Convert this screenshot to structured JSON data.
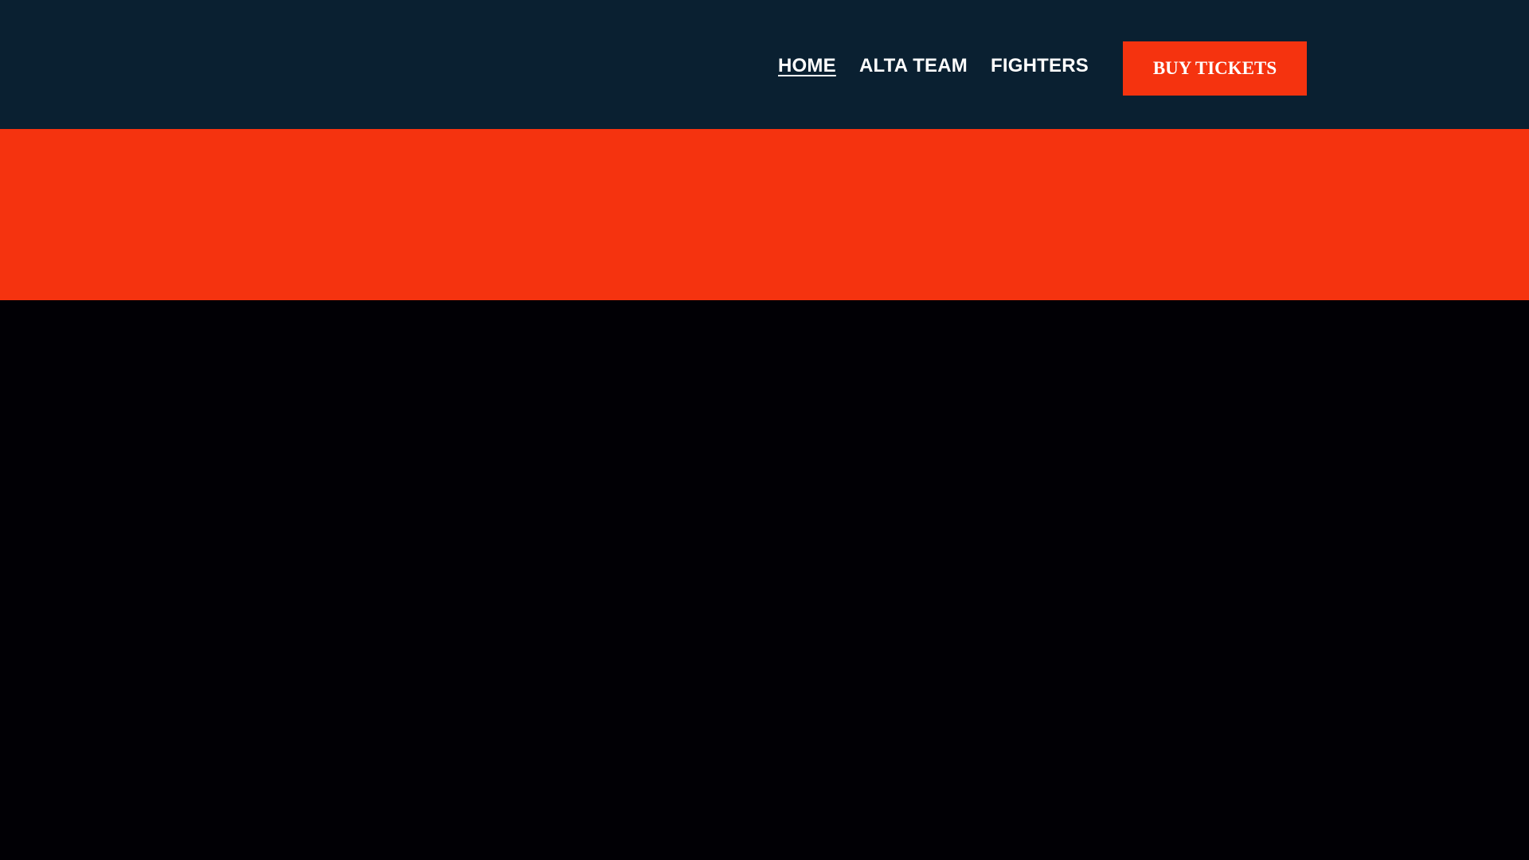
{
  "nav": {
    "items": [
      {
        "label": "HOME",
        "active": true
      },
      {
        "label": "ALTA TEAM",
        "active": false
      },
      {
        "label": "FIGHTERS",
        "active": false
      }
    ],
    "cta_label": "BUY TICKETS"
  },
  "colors": {
    "header_bg": "#0a2031",
    "accent": "#f5330f",
    "body_bg": "#010005"
  }
}
